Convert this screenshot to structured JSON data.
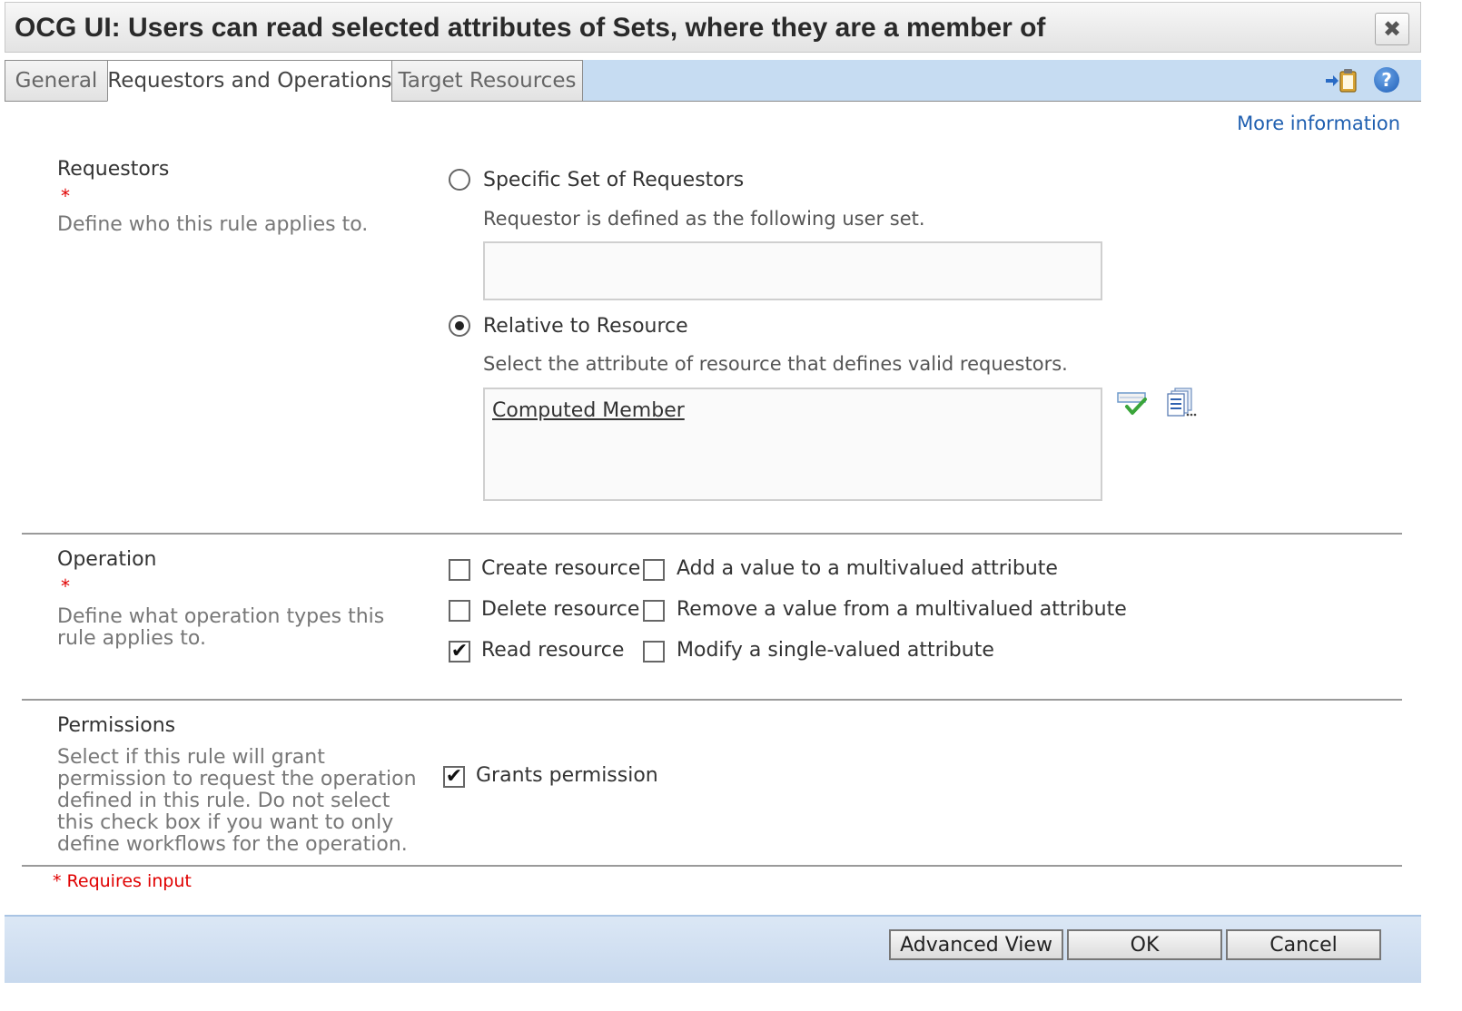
{
  "dialog": {
    "title": "OCG UI: Users can read selected attributes of Sets, where they are a member of",
    "close_glyph": "✖"
  },
  "tabs": [
    {
      "label": "General"
    },
    {
      "label": "Requestors and Operations",
      "active": true
    },
    {
      "label": "Target Resources"
    }
  ],
  "toolbar": {
    "clipboard_icon": "paste-to-clipboard-icon",
    "help_glyph": "?",
    "more_info": "More information"
  },
  "requestors": {
    "title": "Requestors",
    "required_mark": "*",
    "description": "Define who this rule applies to.",
    "specific": {
      "label": "Specific Set of Requestors",
      "hint": "Requestor is defined as the following user set.",
      "value": "",
      "selected": false
    },
    "relative": {
      "label": "Relative to Resource",
      "hint": "Select the attribute of resource that defines valid requestors.",
      "value": "Computed Member",
      "selected": true
    }
  },
  "operation": {
    "title": "Operation",
    "required_mark": "*",
    "description": "Define what operation types this rule applies to.",
    "options": [
      {
        "label": "Create resource",
        "checked": false
      },
      {
        "label": "Delete resource",
        "checked": false
      },
      {
        "label": "Read resource",
        "checked": true
      },
      {
        "label": "Add a value to a multivalued attribute",
        "checked": false
      },
      {
        "label": "Remove a value from a multivalued attribute",
        "checked": false
      },
      {
        "label": "Modify a single-valued attribute",
        "checked": false
      }
    ]
  },
  "permissions": {
    "title": "Permissions",
    "description": "Select if this rule will grant permission to request the operation defined in this rule. Do not select this check box if you want to only define workflows for the operation.",
    "grants": {
      "label": "Grants permission",
      "checked": true
    }
  },
  "requires_input": "* Requires input",
  "footer": {
    "advanced_view": "Advanced View",
    "ok": "OK",
    "cancel": "Cancel"
  },
  "colors": {
    "accent": "#1f5fb0",
    "required": "#e00000",
    "tabstrip": "#c6dcf2"
  }
}
